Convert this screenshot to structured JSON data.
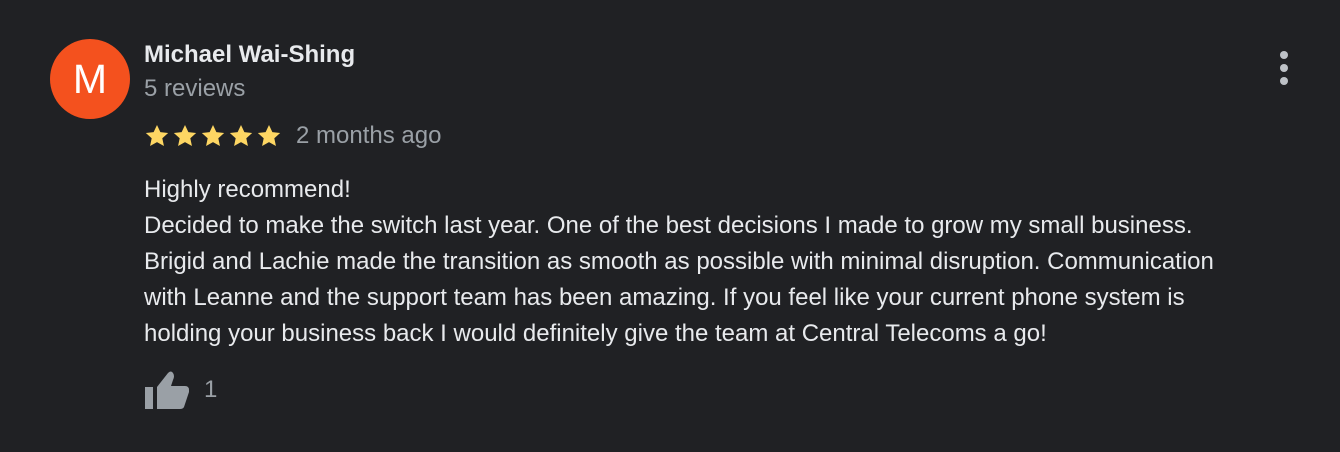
{
  "review": {
    "avatar_letter": "M",
    "avatar_color": "#f4511e",
    "author_name": "Michael Wai-Shing",
    "review_count": "5 reviews",
    "rating": 5,
    "rating_max": 5,
    "star_color": "#fdd663",
    "date": "2 months ago",
    "text_lines": [
      "Highly recommend!",
      "Decided to make the switch last year. One of the best decisions I made to grow my small business.",
      "Brigid and Lachie made the transition as smooth as possible with minimal disruption. Communication",
      "with Leanne and the support team has been amazing. If you feel like your current phone system is",
      "holding your business back I would definitely give the team at Central Telecoms a go!"
    ],
    "like_count": "1",
    "icons": {
      "more": "more-vert-icon",
      "like": "thumb-up-icon",
      "star": "star-icon"
    }
  }
}
